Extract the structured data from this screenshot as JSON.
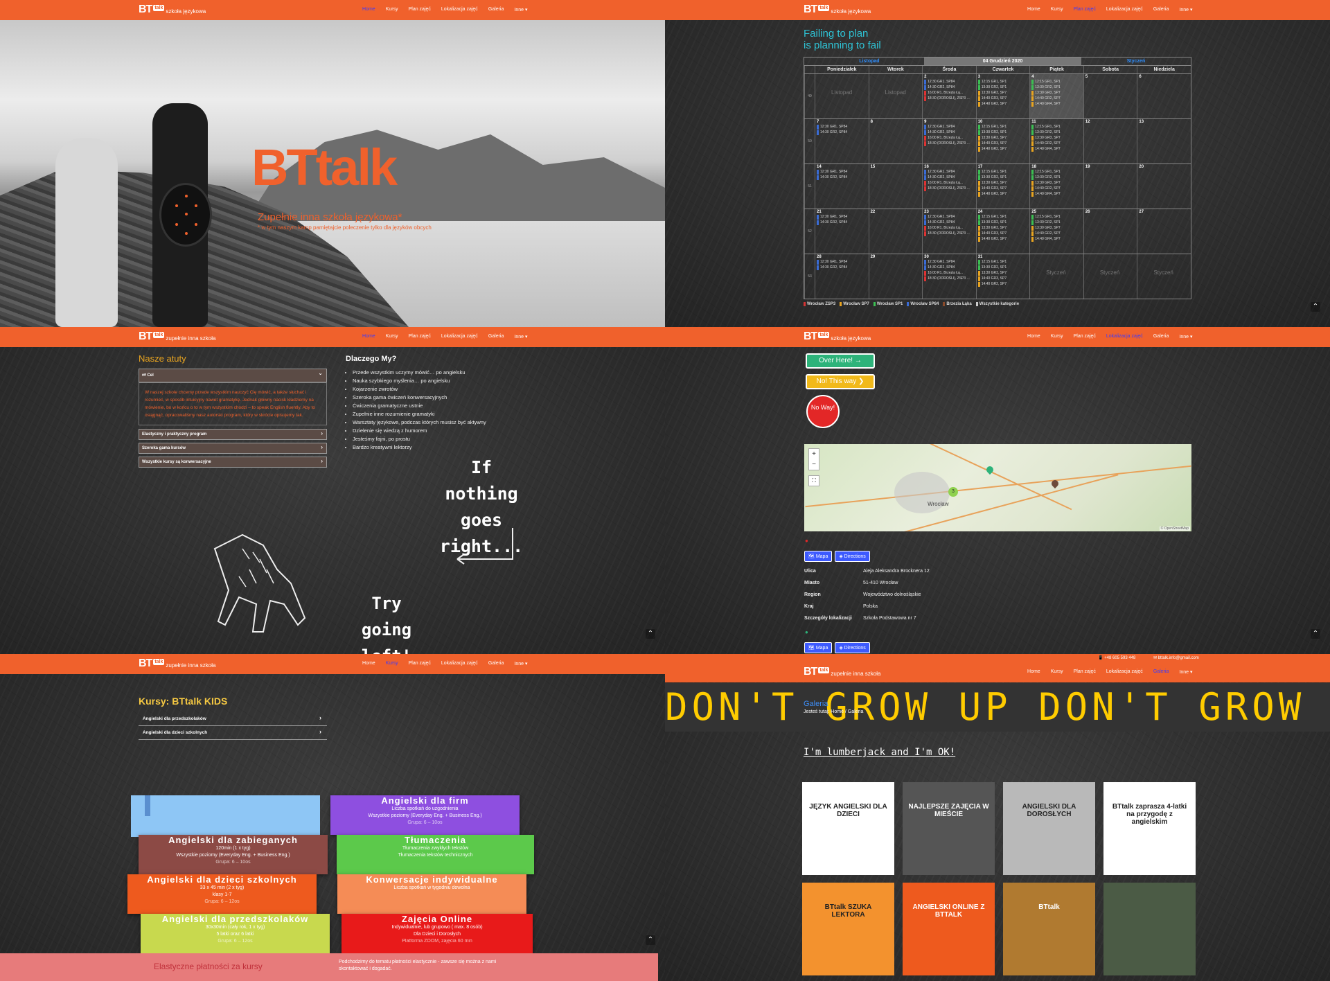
{
  "brand": {
    "bt": "BT",
    "talk": "talk",
    "tag1": "szkoła językowa",
    "tag2": "zupełnie inna szkoła"
  },
  "menu": [
    "Home",
    "Kursy",
    "Plan zajęć",
    "Lokalizacja zajęć",
    "Galeria",
    "Inne ▾"
  ],
  "hero": {
    "title": "BTtalk",
    "subtitle": "Zupełnie inna szkoła językowa*",
    "small": "* w tym naszym kamp pamiętajcie poleczenie tylko dla języków obcych"
  },
  "schedule": {
    "quote_line1": "Failing to plan",
    "quote_line2": "is planning to fail",
    "prev_month": "Listopad",
    "current": "04 Grudzień 2020",
    "next_month": "Styczeń",
    "days": [
      "Poniedziałek",
      "Wtorek",
      "Środa",
      "Czwartek",
      "Piątek",
      "Sobota",
      "Niedziela"
    ],
    "weeks": [
      {
        "n": "49",
        "days": [
          "",
          "",
          "2",
          "3",
          "4",
          "5",
          "6"
        ],
        "grey": "Listopad"
      },
      {
        "n": "50",
        "days": [
          "7",
          "8",
          "9",
          "10",
          "11",
          "12",
          "13"
        ]
      },
      {
        "n": "51",
        "days": [
          "14",
          "15",
          "16",
          "17",
          "18",
          "19",
          "20"
        ]
      },
      {
        "n": "52",
        "days": [
          "21",
          "22",
          "23",
          "24",
          "25",
          "26",
          "27"
        ]
      },
      {
        "n": "53",
        "days": [
          "28",
          "29",
          "30",
          "31",
          "",
          "",
          ""
        ],
        "grey": "Styczeń"
      }
    ],
    "mon_events": [
      "12:30 GR1, SP84",
      "14:30 GR2, SP84"
    ],
    "wed_events": [
      "12:30 GR1, SP84",
      "14:30 GR2, SP84",
      "16:00 R1, Brzezia Łą...",
      "18:30 (DOROŚLI), ZSP3 ..."
    ],
    "thu_events": [
      "12:15 GR1, SP1",
      "13:30 GR2, SP1",
      "13:30 GR3, SP7",
      "14:40 GR3, SP7",
      "14:40 GR2, SP7"
    ],
    "fri_events": [
      "12:15 GR1, SP1",
      "13:30 GR2, SP1",
      "13:30 GR3, SP7",
      "14:40 GR2, SP7",
      "14:40 GR4, SP7"
    ],
    "legend": [
      "Wrocław ZSP3",
      "Wrocław SP7",
      "Wrocław SP1",
      "Wrocław SP84",
      "Brzezia Łąka",
      "Wszystkie kategorie"
    ],
    "legend_colors": [
      "#d33333",
      "#e8a420",
      "#3bbf52",
      "#3a6cd6",
      "#8a4a2a",
      "#cccccc"
    ]
  },
  "about": {
    "heading": "Nasze atuty",
    "cel": "🕫 Cel",
    "cel_text": "W naszej szkole chcemy przede wszystkim nauczyć Cię mówić, a także słuchać i rozumieć, w sposób intuicyjny nawet gramatykę. Jednak główny nacisk kładziemy na mówienie, bo w końcu o to w tym wszystkim chodzi – to speak English fluently. Aby to osiągnąć, opracowaliśmy nasz autorski program, który w skrócie opisujemy tak.",
    "items": [
      "Elastyczny i praktyczny program",
      "Szeroka gama kursów",
      "Wszystkie kursy są konwersacyjne"
    ],
    "why_title": "Dlaczego My?",
    "why": [
      "Przede wszystkim uczymy mówić… po angielsku",
      "Nauka szybkiego myślenia… po angielsku",
      "Kojarzenie zwrotów",
      "Szeroka gama ćwiczeń konwersacyjnych",
      "Ćwiczenia gramatyczne ustnie",
      "Zupełnie inne rozumienie gramatyki",
      "Warsztaty językowe, podczas których musisz być aktywny",
      "Dzielenie się wiedzą z humorem",
      "Jesteśmy fajni, po prostu",
      "Bardzo kreatywni lektorzy"
    ],
    "chalk1": "If nothing goes right...",
    "chalk2": "Try going left!"
  },
  "location": {
    "btn1": "Over Here! →",
    "btn2": "No! This way ❯",
    "btn3": "No Way!",
    "map_city": "Wrocław",
    "map_attr": "© OpenStreetMap",
    "mapa": "🗺 Mapa",
    "directions": "◈ Directions",
    "rows": [
      {
        "k": "Ulica",
        "v": "Aleja Aleksandra Brücknera 12"
      },
      {
        "k": "Miasto",
        "v": "51-410 Wrocław"
      },
      {
        "k": "Region",
        "v": "Województwo dolnośląskie"
      },
      {
        "k": "Kraj",
        "v": "Polska"
      },
      {
        "k": "Szczegóły lokalizacji",
        "v": "Szkoła Podstawowa nr 7"
      }
    ]
  },
  "courses": {
    "kids_title": "Kursy: BTtalk KIDS",
    "kids": [
      "Angielski dla przedszkolaków",
      "Angielski dla dzieci szkolnych"
    ],
    "cards": [
      {
        "t": "Angielski dla firm",
        "l1": "Liczba spotkań do uzgodnienia",
        "l2": "Wszystkie poziomy (Everyday Eng. + Business Eng.)",
        "g": "Grupa: 6 – 10os",
        "c": "#8e4fe0"
      },
      {
        "t": "Angielski dla zabieganych",
        "l1": "120min (1 x tyg)",
        "l2": "Wszystkie poziomy (Everyday Eng. + Business Eng.)",
        "g": "Grupa: 6 – 10os",
        "c": "#8c4a45"
      },
      {
        "t": "Tłumaczenia",
        "l1": "Tłumaczenia zwykłych tekstów",
        "l2": "Tłumaczenia tekstów technicznych",
        "g": "",
        "c": "#5cc94b"
      },
      {
        "t": "Angielski dla dzieci szkolnych",
        "l1": "33 x 45 min (2 x tyg)",
        "l2": "klasy 1-7",
        "g": "Grupa: 6 – 12os",
        "c": "#ee5a1e"
      },
      {
        "t": "Konwersacje indywidualne",
        "l1": "Liczba spotkań w tygodniu dowolna",
        "l2": "",
        "g": "",
        "c": "#f58c56"
      },
      {
        "t": "Angielski dla przedszkolaków",
        "l1": "30x30min (cały rok, 1 x tyg)",
        "l2": "5 latki oraz 6 latki",
        "g": "Grupa: 6 – 12os",
        "c": "#c8d94e"
      },
      {
        "t": "Zajęcia Online",
        "l1": "Indywidualnie, lub grupowo ( max. 8 osób)",
        "l2": "Dla Dzieci i Dorosłych",
        "g": "Platforma ZOOM, zajęcia 60 min",
        "c": "#e81a1a"
      }
    ],
    "pay_title": "Elastyczne płatności za kursy",
    "pay_text": "Podchodzimy do tematu płatności elastycznie - zawsze się można z nami skontaktować i dogadać."
  },
  "gallery": {
    "phone": "📱 +48 605 593 448",
    "email": "✉ bttalk.info@gmail.com",
    "banner": "DON'T GROW UP DON'T GROW UP DON'T GROW",
    "title": "Galeria",
    "breadcrumb": "Jesteś tutaj: Home / Galeria",
    "lumber": "I'm lumberjack and I'm OK!",
    "thumbs": [
      {
        "text": "JĘZYK ANGIELSKI DLA DZIECI",
        "bg": "#ffffff"
      },
      {
        "text": "NAJLEPSZE ZAJĘCIA W MIEŚCIE",
        "bg": "#555555"
      },
      {
        "text": "ANGIELSKI DLA DOROSŁYCH",
        "bg": "#b9b9b9"
      },
      {
        "text": "BTtalk zaprasza 4-latki na przygodę z angielskim",
        "bg": "#ffffff"
      },
      {
        "text": "BTtalk SZUKA LEKTORA",
        "bg": "#f3922e"
      },
      {
        "text": "ANGIELSKI ONLINE Z BTTALK",
        "bg": "#ee5a1e"
      },
      {
        "text": "BTtalk",
        "bg": "#b07a30"
      },
      {
        "text": "",
        "bg": "#4b5b45"
      }
    ]
  }
}
